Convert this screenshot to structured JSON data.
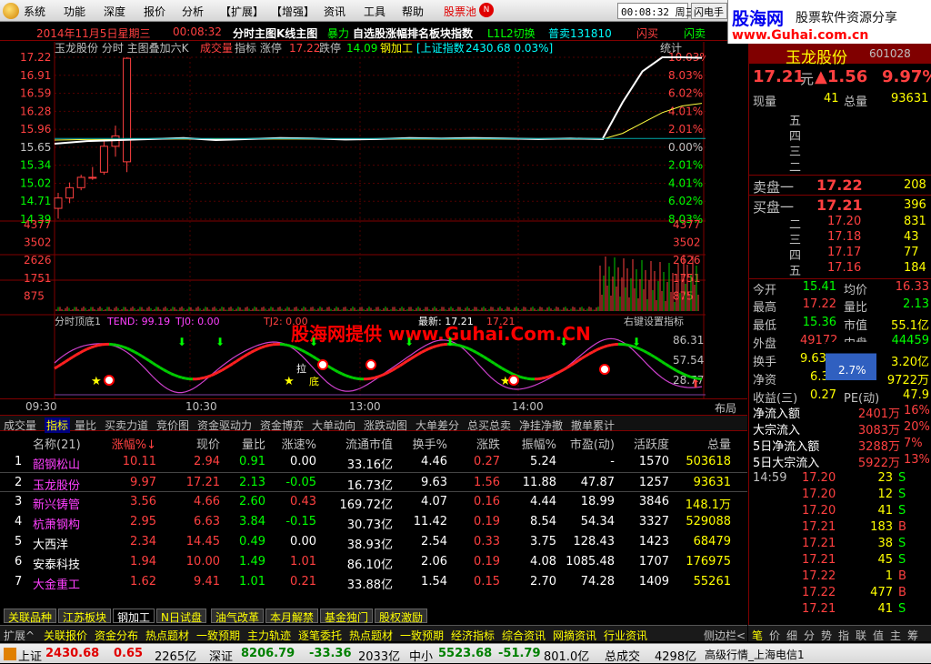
{
  "menu": [
    "系统",
    "功能",
    "深度",
    "报价",
    "分析",
    "【扩展】",
    "【增强】",
    "资讯",
    "工具",
    "帮助"
  ],
  "menu_stockpool": "股票池",
  "menu_badge": "N",
  "clock": "00:08:32 周三",
  "flash_btn": "闪电手",
  "watermark": {
    "brand": "股海网",
    "slogan": "股票软件资源分享",
    "url": "www.Guhai.com.cn",
    "chart_text": "股海网提供 www.Guhai.Com.CN"
  },
  "infobar": {
    "date": "2014年11月5日星期三",
    "time": "00:08:32",
    "title": "分时主图K线主图",
    "title2": "暴力",
    "title3": "自选股涨幅排名板块指数",
    "title4": "L1L2切换",
    "title5": "普卖131810",
    "flash1": "闪买",
    "flash2": "闪卖"
  },
  "chart": {
    "header": "玉龙股份  分时 主图叠加六K",
    "header_cheng": "成交量",
    "header_ind": "指标 涨停",
    "limit_up": "17.22",
    "limit_down_label": "跌停",
    "limit_down": "14.09",
    "sector": "钢加工",
    "index_name": "[上证指数",
    "index_val": "2430.68 0.03%]",
    "stats_btn": "统计",
    "price_ticks": [
      "17.22",
      "16.91",
      "16.59",
      "16.28",
      "15.96",
      "15.65",
      "15.34",
      "15.02",
      "14.71",
      "14.39"
    ],
    "pct_ticks": [
      "10.03%",
      "8.03%",
      "6.02%",
      "4.01%",
      "2.01%",
      "0.00%",
      "2.01%",
      "4.01%",
      "6.02%",
      "8.03%"
    ],
    "vol_ticks": [
      "4377",
      "3502",
      "2626",
      "1751",
      "875"
    ],
    "osc_ticks": [
      "86.31",
      "57.54",
      "28.77"
    ],
    "osc_label": "分时顶底1",
    "osc_tend": "TEND: 99.19",
    "osc_tj0": "TJ0: 0.00",
    "osc_tj2": "TJ2: 0.00",
    "latest": "最新: 17.21",
    "latest2": "17.21",
    "hotkey": "右键设置指标",
    "time_ticks": [
      "09:30",
      "10:30",
      "13:00",
      "14:00"
    ],
    "layout": "布局",
    "markers": [
      "拉",
      "底"
    ]
  },
  "chart_data": {
    "type": "line",
    "price_line_shape": [
      15.55,
      15.6,
      15.62,
      15.64,
      15.66,
      15.62,
      15.64,
      15.66,
      15.65,
      15.63,
      15.64,
      15.66,
      15.65,
      15.66,
      15.65,
      15.64,
      15.65,
      15.64,
      15.65,
      16.35,
      16.95,
      17.22,
      17.22,
      17.21
    ],
    "avg_line_shape": [
      15.62,
      15.63,
      15.63,
      15.64,
      15.64,
      15.64,
      15.64,
      15.64,
      15.64,
      15.64,
      15.64,
      15.64,
      15.64,
      15.64,
      15.64,
      15.64,
      15.64,
      15.64,
      15.64,
      15.75,
      15.95,
      16.15,
      16.28,
      16.33
    ],
    "kline": [
      {
        "o": 14.3,
        "c": 14.5,
        "h": 14.6,
        "l": 14.1
      },
      {
        "o": 14.5,
        "c": 14.7,
        "h": 14.8,
        "l": 14.4
      },
      {
        "o": 14.7,
        "c": 14.9,
        "h": 14.95,
        "l": 14.65
      },
      {
        "o": 14.9,
        "c": 14.9,
        "h": 15.1,
        "l": 14.85
      },
      {
        "o": 15.0,
        "c": 15.5,
        "h": 15.6,
        "l": 14.95
      },
      {
        "o": 15.5,
        "c": 15.7,
        "h": 15.9,
        "l": 15.3
      },
      {
        "o": 15.2,
        "c": 17.2,
        "h": 17.22,
        "l": 15.0
      }
    ]
  },
  "right": {
    "stock_name": "玉龙股份",
    "code": "601028",
    "price": "17.21",
    "unit": "元",
    "change": "▲1.56",
    "pct": "9.97%",
    "now_label": "现量",
    "now_val": "41",
    "total_label": "总量",
    "total_val": "93631",
    "asks": [
      {
        "n": "五",
        "p": "",
        "v": ""
      },
      {
        "n": "四",
        "p": "",
        "v": ""
      },
      {
        "n": "三",
        "p": "",
        "v": ""
      },
      {
        "n": "二",
        "p": "",
        "v": ""
      }
    ],
    "sell1_label": "卖盘一",
    "sell1_p": "17.22",
    "sell1_v": "208",
    "buy_label": "买盘一",
    "buy1_p": "17.21",
    "buy1_v": "396",
    "bids": [
      {
        "n": "二",
        "p": "17.20",
        "v": "831"
      },
      {
        "n": "三",
        "p": "17.18",
        "v": "43"
      },
      {
        "n": "四",
        "p": "17.17",
        "v": "77"
      },
      {
        "n": "五",
        "p": "17.16",
        "v": "184"
      }
    ],
    "stats": [
      {
        "l1": "今开",
        "v1": "15.41",
        "l2": "均价",
        "v2": "16.33"
      },
      {
        "l1": "最高",
        "v1": "17.22",
        "l2": "量比",
        "v2": "2.13"
      },
      {
        "l1": "最低",
        "v1": "15.36",
        "l2": "市值",
        "v2": "55.1亿"
      },
      {
        "l1": "外盘",
        "v1": "49172",
        "l2": "内盘",
        "v2": "44459"
      },
      {
        "l1": "换手",
        "v1": "9.63%",
        "l2": "",
        "v2": "3.20亿"
      },
      {
        "l1": "净资",
        "v1": "6.33",
        "l2": "",
        "v2": "9722万"
      },
      {
        "l1": "收益(三)",
        "v1": "0.27",
        "l2": "PE(动)",
        "v2": "47.9"
      }
    ],
    "gauge": "2.7%",
    "flows": [
      {
        "l": "净流入额",
        "v": "2401万",
        "p": "16%"
      },
      {
        "l": "大宗流入",
        "v": "3083万",
        "p": "20%"
      },
      {
        "l": "5日净流入额",
        "v": "3288万",
        "p": "7%"
      },
      {
        "l": "5日大宗流入",
        "v": "5922万",
        "p": "13%"
      }
    ],
    "ticks": [
      {
        "t": "14:59",
        "p": "17.20",
        "v": "23",
        "s": "S"
      },
      {
        "t": "",
        "p": "17.20",
        "v": "12",
        "s": "S"
      },
      {
        "t": "",
        "p": "17.20",
        "v": "41",
        "s": "S"
      },
      {
        "t": "",
        "p": "17.21",
        "v": "183",
        "s": "B"
      },
      {
        "t": "",
        "p": "17.21",
        "v": "38",
        "s": "S"
      },
      {
        "t": "",
        "p": "17.21",
        "v": "45",
        "s": "S"
      },
      {
        "t": "",
        "p": "17.22",
        "v": "1",
        "s": "B"
      },
      {
        "t": "",
        "p": "17.22",
        "v": "477",
        "s": "B"
      },
      {
        "t": "",
        "p": "17.21",
        "v": "41",
        "s": "S"
      }
    ],
    "tabs": [
      "笔",
      "价",
      "细",
      "分",
      "势",
      "指",
      "联",
      "值",
      "主",
      "筹"
    ]
  },
  "tabs1": [
    "成交量",
    "指标",
    "量比",
    "买卖力道",
    "竞价图",
    "资金驱动力",
    "资金博弈",
    "大单动向",
    "涨跌动图",
    "大单差分",
    "总买总卖",
    "净挂净撤",
    "撤单累计"
  ],
  "table": {
    "headers": [
      "名称(21)",
      "涨幅%↓",
      "现价",
      "量比",
      "涨速%",
      "流通市值",
      "换手%",
      "涨跌",
      "振幅%",
      "市盈(动)",
      "活跃度",
      "总量"
    ],
    "rows": [
      [
        "1",
        "韶钢松山",
        "10.11",
        "2.94",
        "0.91",
        "0.00",
        "33.16亿",
        "4.46",
        "0.27",
        "5.24",
        "-",
        "1570",
        "503618"
      ],
      [
        "2",
        "玉龙股份",
        "9.97",
        "17.21",
        "2.13",
        "-0.05",
        "16.73亿",
        "9.63",
        "1.56",
        "11.88",
        "47.87",
        "1257",
        "93631"
      ],
      [
        "3",
        "新兴铸管",
        "3.56",
        "4.66",
        "2.60",
        "0.43",
        "169.72亿",
        "4.07",
        "0.16",
        "4.44",
        "18.99",
        "3846",
        "148.1万"
      ],
      [
        "4",
        "杭萧钢构",
        "2.95",
        "6.63",
        "3.84",
        "-0.15",
        "30.73亿",
        "11.42",
        "0.19",
        "8.54",
        "54.34",
        "3327",
        "529088"
      ],
      [
        "5",
        "大西洋",
        "2.34",
        "14.45",
        "0.49",
        "0.00",
        "38.93亿",
        "2.54",
        "0.33",
        "3.75",
        "128.43",
        "1423",
        "68479"
      ],
      [
        "6",
        "安泰科技",
        "1.94",
        "10.00",
        "1.49",
        "1.01",
        "86.10亿",
        "2.06",
        "0.19",
        "4.08",
        "1085.48",
        "1707",
        "176975"
      ],
      [
        "7",
        "大金重工",
        "1.62",
        "9.41",
        "1.01",
        "0.21",
        "33.88亿",
        "1.54",
        "0.15",
        "2.70",
        "74.28",
        "1409",
        "55261"
      ]
    ]
  },
  "sectors": [
    "关联品种",
    "江苏板块",
    "钢加工",
    "N日试盘",
    "油气改革",
    "本月解禁",
    "基金独门",
    "股权激励"
  ],
  "bottomtabs": [
    "扩展^",
    "关联报价",
    "资金分布",
    "热点题材",
    "一致预期",
    "主力轨迹",
    "逐笔委托",
    "热点题材",
    "一致预期",
    "经济指标",
    "综合资讯",
    "网摘资讯",
    "行业资讯"
  ],
  "status": {
    "sh_label": "上证",
    "sh_val": "2430.68",
    "sh_chg": "0.65",
    "sh_amt": "2265亿",
    "sz_label": "深证",
    "sz_val": "8206.79",
    "sz_chg": "-33.36",
    "sz_amt": "2033亿",
    "zx_label": "中小",
    "zx_val": "5523.68",
    "zx_chg": "-51.79",
    "zx_amt": "801.0亿",
    "total_label": "总成交",
    "total_val": "4298亿",
    "level": "高级行情_上海电信1"
  },
  "sidebar_close": "侧边栏<"
}
